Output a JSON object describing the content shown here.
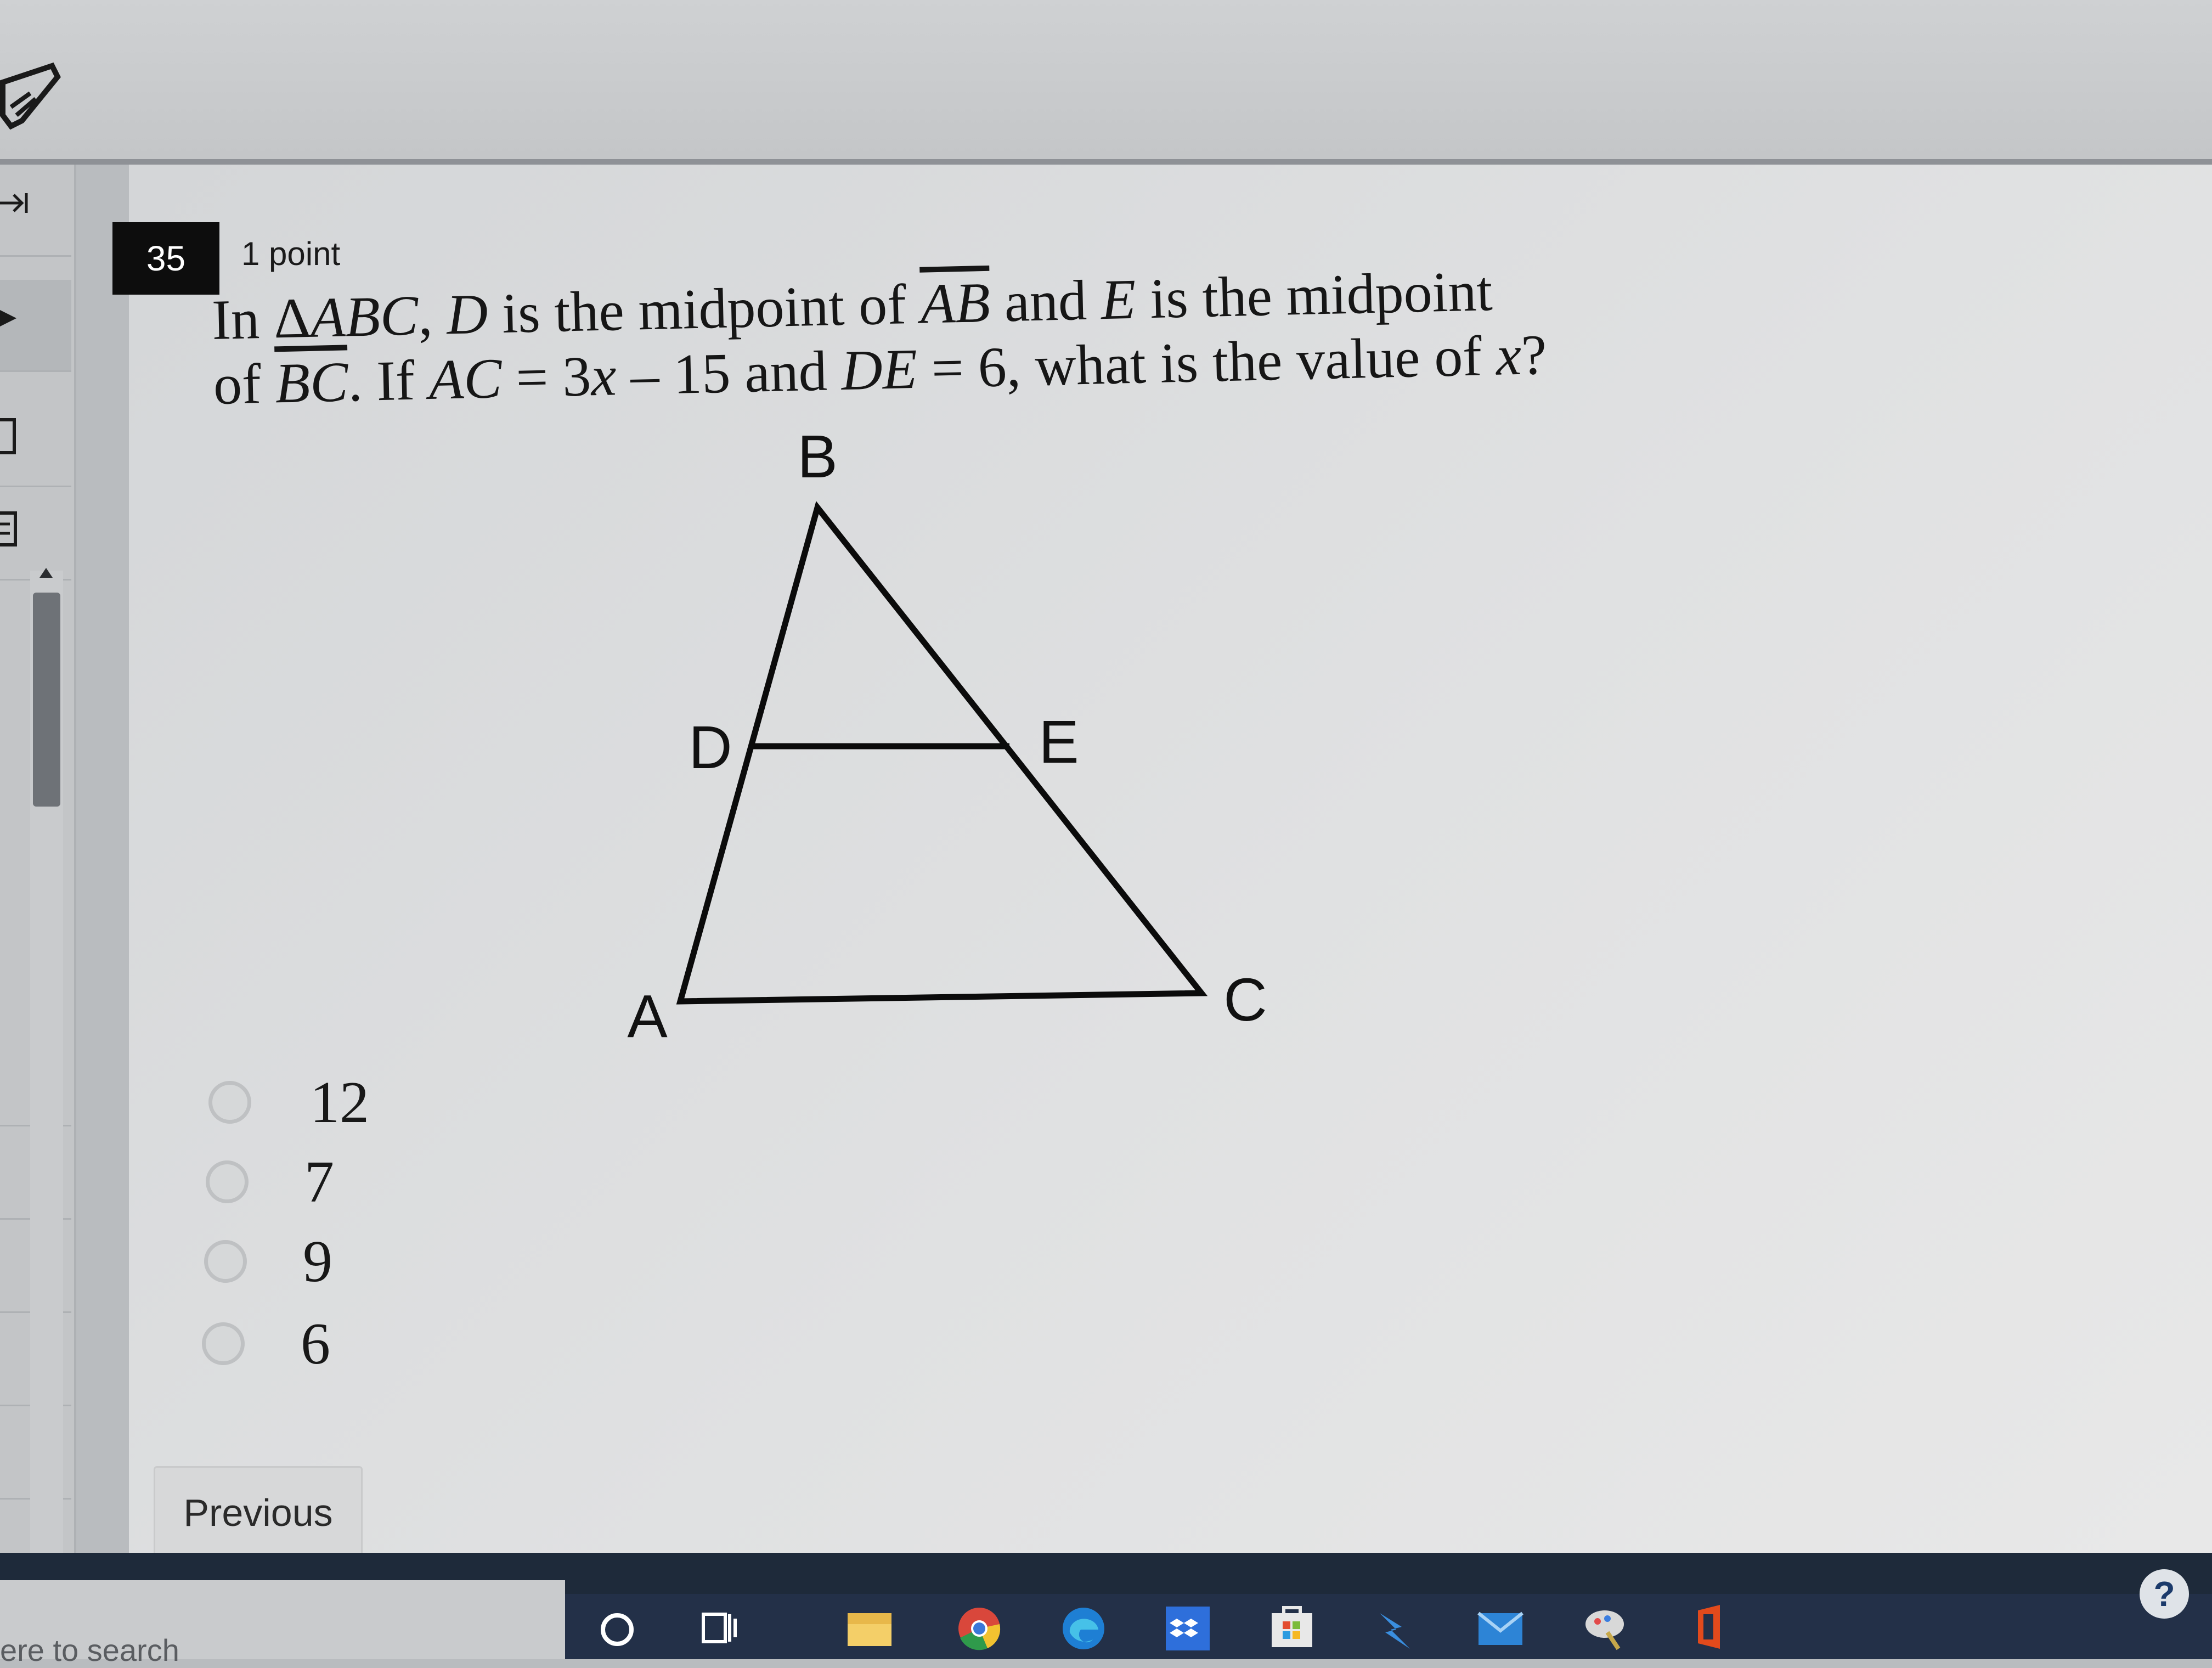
{
  "question": {
    "number": "35",
    "points": "1 point",
    "line1": [
      {
        "t": "In Δ",
        "s": "n"
      },
      {
        "t": "ABC",
        "s": "i"
      },
      {
        "t": ", ",
        "s": "n"
      },
      {
        "t": "D",
        "s": "i"
      },
      {
        "t": " is the midpoint of ",
        "s": "n"
      },
      {
        "t": "AB",
        "s": "o"
      },
      {
        "t": " and ",
        "s": "n"
      },
      {
        "t": "E",
        "s": "i"
      },
      {
        "t": " is the midpoint",
        "s": "n"
      }
    ],
    "line2": [
      {
        "t": "of ",
        "s": "n"
      },
      {
        "t": "BC",
        "s": "o"
      },
      {
        "t": ". If ",
        "s": "n"
      },
      {
        "t": "AC",
        "s": "i"
      },
      {
        "t": " = 3",
        "s": "n"
      },
      {
        "t": "x",
        "s": "i"
      },
      {
        "t": " – 15 and ",
        "s": "n"
      },
      {
        "t": "DE",
        "s": "i"
      },
      {
        "t": " = 6, what is the value of ",
        "s": "n"
      },
      {
        "t": "x",
        "s": "i"
      },
      {
        "t": "?",
        "s": "n"
      }
    ]
  },
  "figure": {
    "labels": {
      "A": "A",
      "B": "B",
      "C": "C",
      "D": "D",
      "E": "E"
    }
  },
  "choices": [
    {
      "label": "12",
      "selected": false
    },
    {
      "label": "7",
      "selected": false
    },
    {
      "label": "9",
      "selected": false
    },
    {
      "label": "6",
      "selected": false
    }
  ],
  "nav": {
    "previous_label": "Previous"
  },
  "taskbar": {
    "search_placeholder": "ere to search",
    "icons": [
      "cortana-icon",
      "task-view-icon",
      "file-explorer-icon",
      "chrome-icon",
      "edge-icon",
      "dropbox-icon",
      "microsoft-store-icon",
      "power-automate-icon",
      "mail-icon",
      "paint-icon",
      "office-icon"
    ]
  },
  "colors": {
    "question_badge": "#0d0d0d",
    "taskbar": "#233048",
    "text": "#161616"
  }
}
